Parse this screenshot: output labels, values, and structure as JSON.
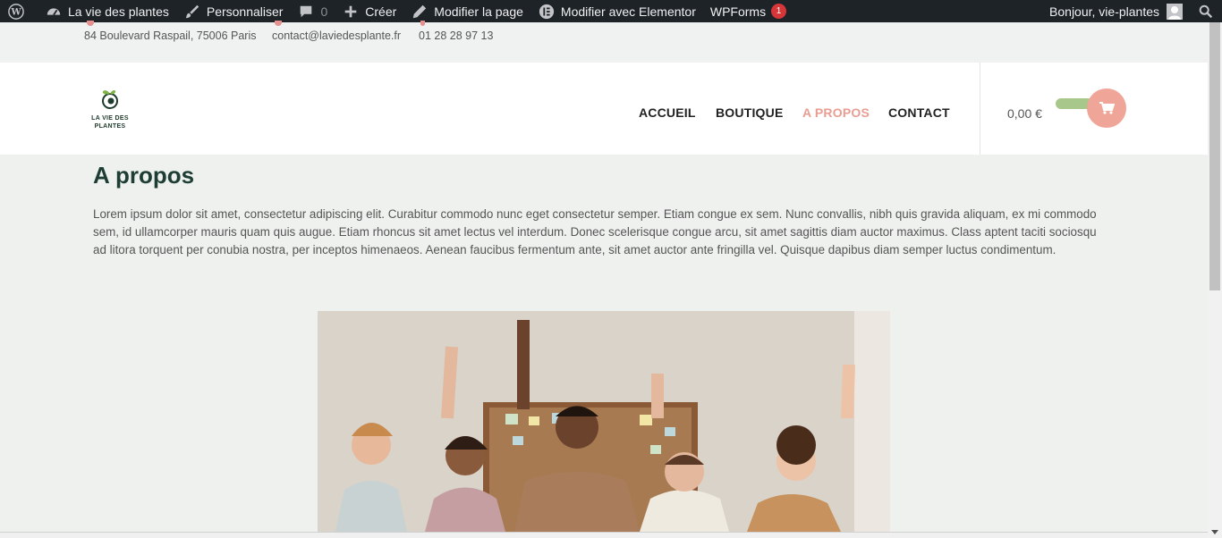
{
  "admin_bar": {
    "site_name": "La vie des plantes",
    "customize": "Personnaliser",
    "comments_count": "0",
    "new": "Créer",
    "edit_page": "Modifier la page",
    "edit_elementor": "Modifier avec Elementor",
    "wpforms": "WPForms",
    "wpforms_badge": "1",
    "greeting": "Bonjour, vie-plantes"
  },
  "topbar": {
    "address": "84 Boulevard Raspail, 75006 Paris",
    "email": "contact@laviedesplante.fr",
    "phone": "01 28 28 97 13"
  },
  "header": {
    "logo_line1": "LA VIE DES",
    "logo_line2": "PLANTES",
    "nav": [
      "ACCUEIL",
      "BOUTIQUE",
      "A PROPOS",
      "CONTACT"
    ],
    "active_nav": "A PROPOS",
    "cart_total": "0,00 €"
  },
  "main": {
    "title": "A propos",
    "lead": "Lorem ipsum dolor sit amet, consectetur adipiscing elit. Curabitur commodo nunc eget consectetur semper. Etiam congue ex sem. Nunc convallis, nibh quis gravida aliquam, ex mi commodo sem, id ullamcorper mauris quam quis augue. Etiam rhoncus sit amet lectus vel interdum. Donec scelerisque congue arcu, sit amet sagittis diam auctor maximus. Class aptent taciti sociosqu ad litora torquent per conubia nostra, per inceptos himenaeos. Aenean faucibus fermentum ante, sit amet auctor ante fringilla vel. Quisque dapibus diam semper luctus condimentum."
  },
  "colors": {
    "admin_bar": "#1d2327",
    "accent_pink": "#efa597",
    "accent_green": "#a7c88a",
    "title_green": "#1e3e35",
    "page_bg": "#eef1ee"
  },
  "icons": [
    "wordpress-icon",
    "dashboard-icon",
    "brush-icon",
    "comment-icon",
    "plus-icon",
    "pencil-icon",
    "elementor-icon",
    "search-icon",
    "cart-icon",
    "logo-leaf-icon"
  ]
}
